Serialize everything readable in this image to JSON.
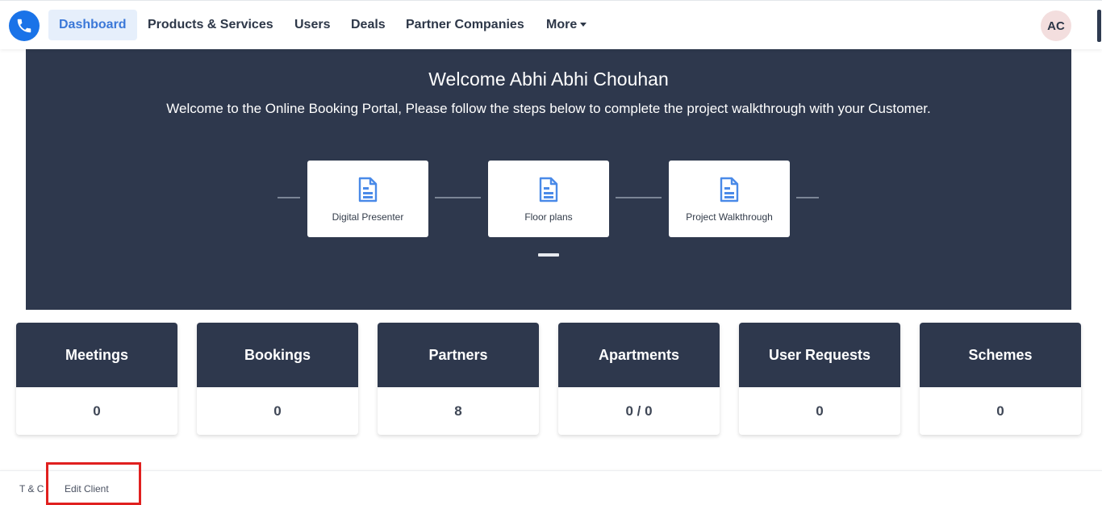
{
  "nav": {
    "logo_icon": "phone-icon",
    "items": [
      {
        "label": "Dashboard"
      },
      {
        "label": "Products & Services"
      },
      {
        "label": "Users"
      },
      {
        "label": "Deals"
      },
      {
        "label": "Partner Companies"
      },
      {
        "label": "More"
      }
    ],
    "avatar": "AC"
  },
  "hero": {
    "title": "Welcome Abhi Abhi Chouhan",
    "subtitle": "Welcome to the Online Booking Portal, Please follow the steps below to complete the project walkthrough with your Customer.",
    "steps": [
      {
        "label": "Digital Presenter",
        "icon": "document-icon"
      },
      {
        "label": "Floor plans",
        "icon": "document-icon"
      },
      {
        "label": "Project Walkthrough",
        "icon": "document-icon"
      }
    ]
  },
  "stats": [
    {
      "label": "Meetings",
      "value": "0"
    },
    {
      "label": "Bookings",
      "value": "0"
    },
    {
      "label": "Partners",
      "value": "8"
    },
    {
      "label": "Apartments",
      "value": "0 / 0"
    },
    {
      "label": "User Requests",
      "value": "0"
    },
    {
      "label": "Schemes",
      "value": "0"
    }
  ],
  "footer": {
    "tc": "T & C",
    "edit_client": "Edit Client"
  },
  "colors": {
    "accent": "#1a73e8",
    "dark_panel": "#2e384d",
    "highlight": "#e0201f"
  }
}
